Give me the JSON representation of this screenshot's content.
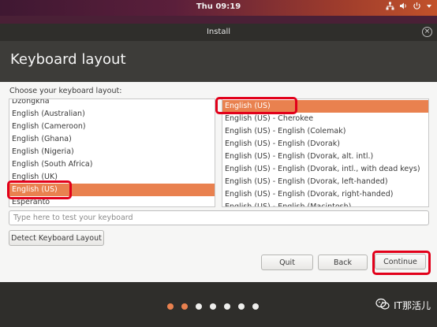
{
  "panel": {
    "clock": "Thu 09:19"
  },
  "window": {
    "title": "Install",
    "close_glyph": "×"
  },
  "page": {
    "heading": "Keyboard layout",
    "prompt": "Choose your keyboard layout:"
  },
  "layouts": [
    {
      "label": "Dzongkha",
      "selected": false
    },
    {
      "label": "English (Australian)",
      "selected": false
    },
    {
      "label": "English (Cameroon)",
      "selected": false
    },
    {
      "label": "English (Ghana)",
      "selected": false
    },
    {
      "label": "English (Nigeria)",
      "selected": false
    },
    {
      "label": "English (South Africa)",
      "selected": false
    },
    {
      "label": "English (UK)",
      "selected": false
    },
    {
      "label": "English (US)",
      "selected": true
    },
    {
      "label": "Esperanto",
      "selected": false
    }
  ],
  "variants": [
    {
      "label": "English (US)",
      "selected": true
    },
    {
      "label": "English (US) - Cherokee",
      "selected": false
    },
    {
      "label": "English (US) - English (Colemak)",
      "selected": false
    },
    {
      "label": "English (US) - English (Dvorak)",
      "selected": false
    },
    {
      "label": "English (US) - English (Dvorak, alt. intl.)",
      "selected": false
    },
    {
      "label": "English (US) - English (Dvorak, intl., with dead keys)",
      "selected": false
    },
    {
      "label": "English (US) - English (Dvorak, left-handed)",
      "selected": false
    },
    {
      "label": "English (US) - English (Dvorak, right-handed)",
      "selected": false
    },
    {
      "label": "English (US) - English (Macintosh)",
      "selected": false
    }
  ],
  "test_input": {
    "placeholder": "Type here to test your keyboard",
    "value": ""
  },
  "buttons": {
    "detect": "Detect Keyboard Layout",
    "quit": "Quit",
    "back": "Back",
    "continue": "Continue"
  },
  "progress": {
    "total_steps": 7,
    "active_steps": 2
  },
  "watermark": {
    "text": "IT那活儿"
  },
  "colors": {
    "accent": "#e9814f",
    "highlight": "#e2001a",
    "header": "#3d3c39"
  }
}
